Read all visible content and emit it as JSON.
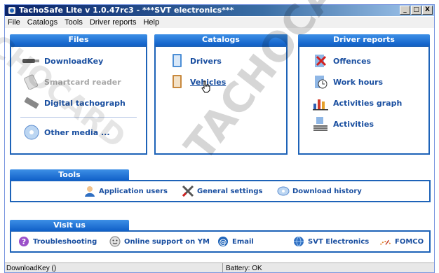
{
  "window": {
    "title": "TachoSafe Lite v 1.0.47rc3 - ***SVT electronics***",
    "buttons": {
      "minimize": "_",
      "maximize": "□",
      "close": "X"
    }
  },
  "menu": [
    "File",
    "Catalogs",
    "Tools",
    "Driver reports",
    "Help"
  ],
  "files": {
    "header": "Files",
    "items": [
      {
        "label": "DownloadKey",
        "icon": "usb-key-icon",
        "enabled": true
      },
      {
        "label": "Smartcard reader",
        "icon": "card-reader-icon",
        "enabled": false
      },
      {
        "label": "Digital tachograph",
        "icon": "tachograph-icon",
        "enabled": true
      },
      {
        "label": "Other media ...",
        "icon": "disc-icon",
        "enabled": true
      }
    ]
  },
  "catalogs": {
    "header": "Catalogs",
    "items": [
      {
        "label": "Drivers",
        "icon": "book-icon"
      },
      {
        "label": "Vehicles",
        "icon": "book-icon"
      }
    ]
  },
  "reports": {
    "header": "Driver reports",
    "items": [
      {
        "label": "Offences",
        "icon": "offence-icon"
      },
      {
        "label": "Work hours",
        "icon": "clock-icon"
      },
      {
        "label": "Activities graph",
        "icon": "bar-chart-icon"
      },
      {
        "label": "Activities",
        "icon": "list-icon"
      }
    ]
  },
  "tools": {
    "header": "Tools",
    "items": [
      {
        "label": "Application users",
        "icon": "user-icon"
      },
      {
        "label": "General settings",
        "icon": "wrench-icon"
      },
      {
        "label": "Download history",
        "icon": "history-icon"
      }
    ]
  },
  "visit": {
    "header": "Visit us",
    "items": [
      {
        "label": "Troubleshooting",
        "icon": "help-icon"
      },
      {
        "label": "Online support on YM",
        "icon": "smiley-icon"
      },
      {
        "label": "Email",
        "icon": "at-icon"
      },
      {
        "label": "SVT Electronics",
        "icon": "globe-icon"
      },
      {
        "label": "FOMCO",
        "icon": "fomco-logo-icon"
      }
    ]
  },
  "status": {
    "left": "DownloadKey ()",
    "right": "Battery: OK"
  },
  "watermark": "TACHOCARD",
  "colors": {
    "accent": "#1e63b8",
    "link": "#1a4fa0",
    "disabled": "#a8a8a8"
  }
}
